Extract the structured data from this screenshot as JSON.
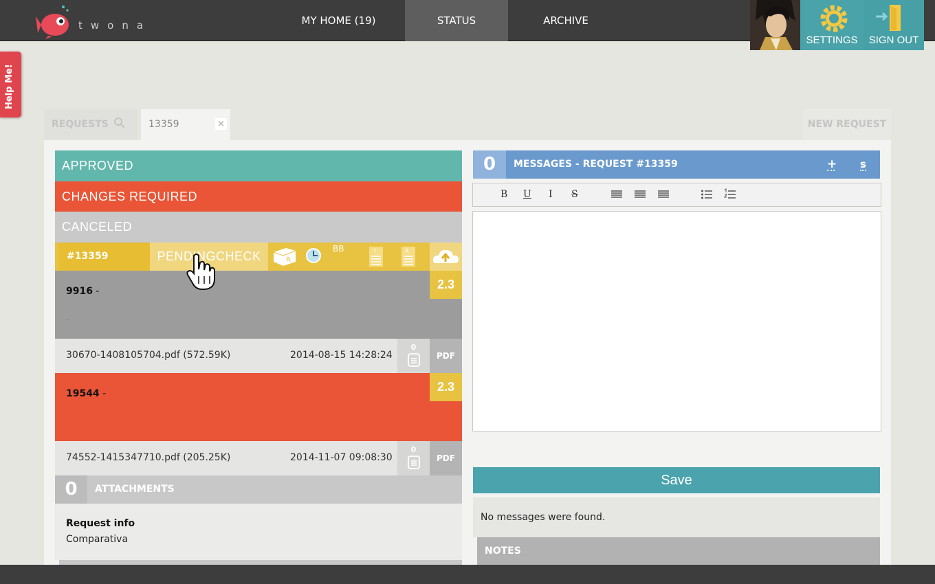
{
  "app": {
    "logo_text": "twona"
  },
  "nav": {
    "home": "MY HOME (19)",
    "status": "STATUS",
    "archive": "ARCHIVE",
    "settings": "SETTINGS",
    "sign_out": "SIGN OUT"
  },
  "help": {
    "label": "Help Me!"
  },
  "tabs": {
    "requests": "REQUESTS",
    "current": "13359",
    "new_request": "NEW REQUEST"
  },
  "statuses": {
    "approved": "APPROVED",
    "changes_required": "CHANGES REQUIRED",
    "canceled": "CANCELED"
  },
  "request": {
    "id": "#13359",
    "state": "PENDINGCHECK",
    "icon_labels": {
      "box": "R",
      "bb": "BB",
      "t": "T",
      "r": "R"
    },
    "items": [
      {
        "code": "9916",
        "suffix": " -",
        "note": ".",
        "score": "2.3",
        "file": "30670-1408105704.pdf (572.59K)",
        "date": "2014-08-15 14:28:24",
        "comments": "0",
        "type": "PDF"
      },
      {
        "code": "19544",
        "suffix": " -",
        "score": "2.3",
        "file": "74552-1415347710.pdf (205.25K)",
        "date": "2014-11-07 09:08:30",
        "comments": "0",
        "type": "PDF"
      }
    ],
    "attachments_count": "0",
    "attachments_label": "ATTACHMENTS",
    "info_title": "Request info",
    "info_value": "Comparativa"
  },
  "messages": {
    "count": "0",
    "title": "MESSAGES - REQUEST #13359",
    "plus": "+",
    "s": "s",
    "toolbar": {
      "bold": "B",
      "underline": "U",
      "italic": "I",
      "strike": "S"
    },
    "save": "Save",
    "empty": "No messages were found.",
    "notes": "NOTES"
  },
  "colors": {
    "approved": "#62b7ac",
    "changes": "#e95536",
    "pending": "#e8c241",
    "messages": "#6a9acd",
    "save": "#4aa3ad"
  }
}
